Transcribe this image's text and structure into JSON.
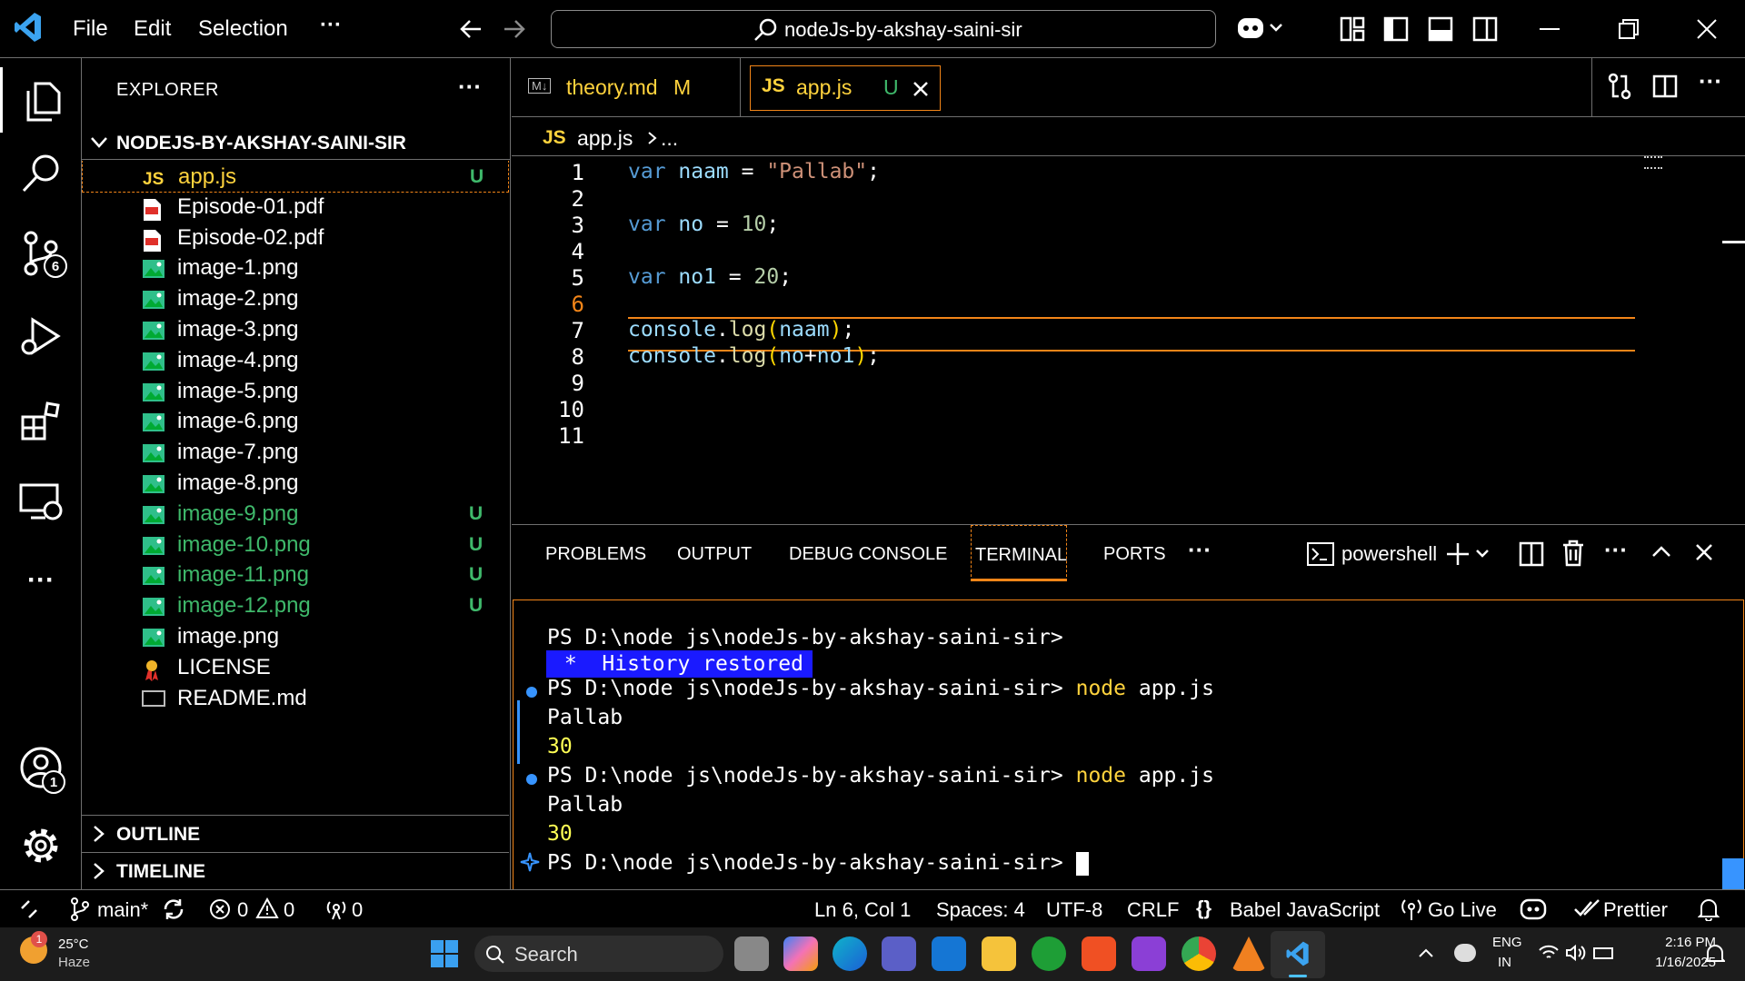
{
  "titlebar": {
    "menu": [
      "File",
      "Edit",
      "Selection",
      "···"
    ],
    "search": "nodeJs-by-akshay-saini-sir"
  },
  "activity": {
    "scm_badge": "6",
    "account_badge": "1"
  },
  "sidebar": {
    "title": "EXPLORER",
    "folder": "NODEJS-BY-AKSHAY-SAINI-SIR",
    "files": [
      {
        "name": "app.js",
        "status": "U",
        "type": "js"
      },
      {
        "name": "Episode-01.pdf",
        "status": "",
        "type": "pdf"
      },
      {
        "name": "Episode-02.pdf",
        "status": "",
        "type": "pdf"
      },
      {
        "name": "image-1.png",
        "status": "",
        "type": "img"
      },
      {
        "name": "image-2.png",
        "status": "",
        "type": "img"
      },
      {
        "name": "image-3.png",
        "status": "",
        "type": "img"
      },
      {
        "name": "image-4.png",
        "status": "",
        "type": "img"
      },
      {
        "name": "image-5.png",
        "status": "",
        "type": "img"
      },
      {
        "name": "image-6.png",
        "status": "",
        "type": "img"
      },
      {
        "name": "image-7.png",
        "status": "",
        "type": "img"
      },
      {
        "name": "image-8.png",
        "status": "",
        "type": "img"
      },
      {
        "name": "image-9.png",
        "status": "U",
        "type": "img"
      },
      {
        "name": "image-10.png",
        "status": "U",
        "type": "img"
      },
      {
        "name": "image-11.png",
        "status": "U",
        "type": "img"
      },
      {
        "name": "image-12.png",
        "status": "U",
        "type": "img"
      },
      {
        "name": "image.png",
        "status": "",
        "type": "img"
      },
      {
        "name": "LICENSE",
        "status": "",
        "type": "license"
      },
      {
        "name": "README.md",
        "status": "",
        "type": "md"
      }
    ],
    "outline": "OUTLINE",
    "timeline": "TIMELINE"
  },
  "tabs": [
    {
      "icon": "M↓",
      "label": "theory.md",
      "status": "M"
    },
    {
      "icon": "JS",
      "label": "app.js",
      "status": "U"
    }
  ],
  "breadcrumb": {
    "icon": "JS",
    "file": "app.js",
    "rest": "..."
  },
  "editor": {
    "line_numbers": [
      "1",
      "2",
      "3",
      "4",
      "5",
      "6",
      "7",
      "8",
      "9",
      "10",
      "11"
    ],
    "lines": [
      [
        {
          "t": "var ",
          "c": "kw"
        },
        {
          "t": "naam",
          "c": "var"
        },
        {
          "t": " = ",
          "c": "op"
        },
        {
          "t": "\"Pallab\"",
          "c": "str"
        },
        {
          "t": ";",
          "c": "op"
        }
      ],
      [],
      [
        {
          "t": "var ",
          "c": "kw"
        },
        {
          "t": "no",
          "c": "var"
        },
        {
          "t": " = ",
          "c": "op"
        },
        {
          "t": "10",
          "c": "num"
        },
        {
          "t": ";",
          "c": "op"
        }
      ],
      [],
      [
        {
          "t": "var ",
          "c": "kw"
        },
        {
          "t": "no1",
          "c": "var"
        },
        {
          "t": " = ",
          "c": "op"
        },
        {
          "t": "20",
          "c": "num"
        },
        {
          "t": ";",
          "c": "op"
        }
      ],
      [],
      [
        {
          "t": "console",
          "c": "var"
        },
        {
          "t": ".",
          "c": "op"
        },
        {
          "t": "log",
          "c": "fn"
        },
        {
          "t": "(",
          "c": "par"
        },
        {
          "t": "naam",
          "c": "var"
        },
        {
          "t": ")",
          "c": "par"
        },
        {
          "t": ";",
          "c": "op"
        }
      ],
      [
        {
          "t": "console",
          "c": "var"
        },
        {
          "t": ".",
          "c": "op"
        },
        {
          "t": "log",
          "c": "fn"
        },
        {
          "t": "(",
          "c": "par"
        },
        {
          "t": "no",
          "c": "var"
        },
        {
          "t": "+",
          "c": "op"
        },
        {
          "t": "no1",
          "c": "var"
        },
        {
          "t": ")",
          "c": "par"
        },
        {
          "t": ";",
          "c": "op"
        }
      ],
      [],
      [],
      []
    ]
  },
  "panel": {
    "tabs": [
      "PROBLEMS",
      "OUTPUT",
      "DEBUG CONSOLE",
      "TERMINAL",
      "PORTS",
      "···"
    ],
    "shell": "powershell",
    "history": " *  History restored ",
    "prompt": "PS D:\\node js\\nodeJs-by-akshay-saini-sir>",
    "command": "node",
    "arg": "app.js",
    "output1": "Pallab",
    "output2": "30"
  },
  "status": {
    "branch": "main*",
    "errors": "0",
    "warnings": "0",
    "ports": "0",
    "position": "Ln 6, Col 1",
    "spaces": "Spaces: 4",
    "encoding": "UTF-8",
    "eol": "CRLF",
    "language": "Babel JavaScript",
    "golive": "Go Live",
    "prettier": "Prettier"
  },
  "taskbar": {
    "weather_temp": "25°C",
    "weather_desc": "Haze",
    "weather_badge": "1",
    "search": "Search",
    "lang1": "ENG",
    "lang2": "IN",
    "time": "2:16 PM",
    "date": "1/16/2025"
  }
}
